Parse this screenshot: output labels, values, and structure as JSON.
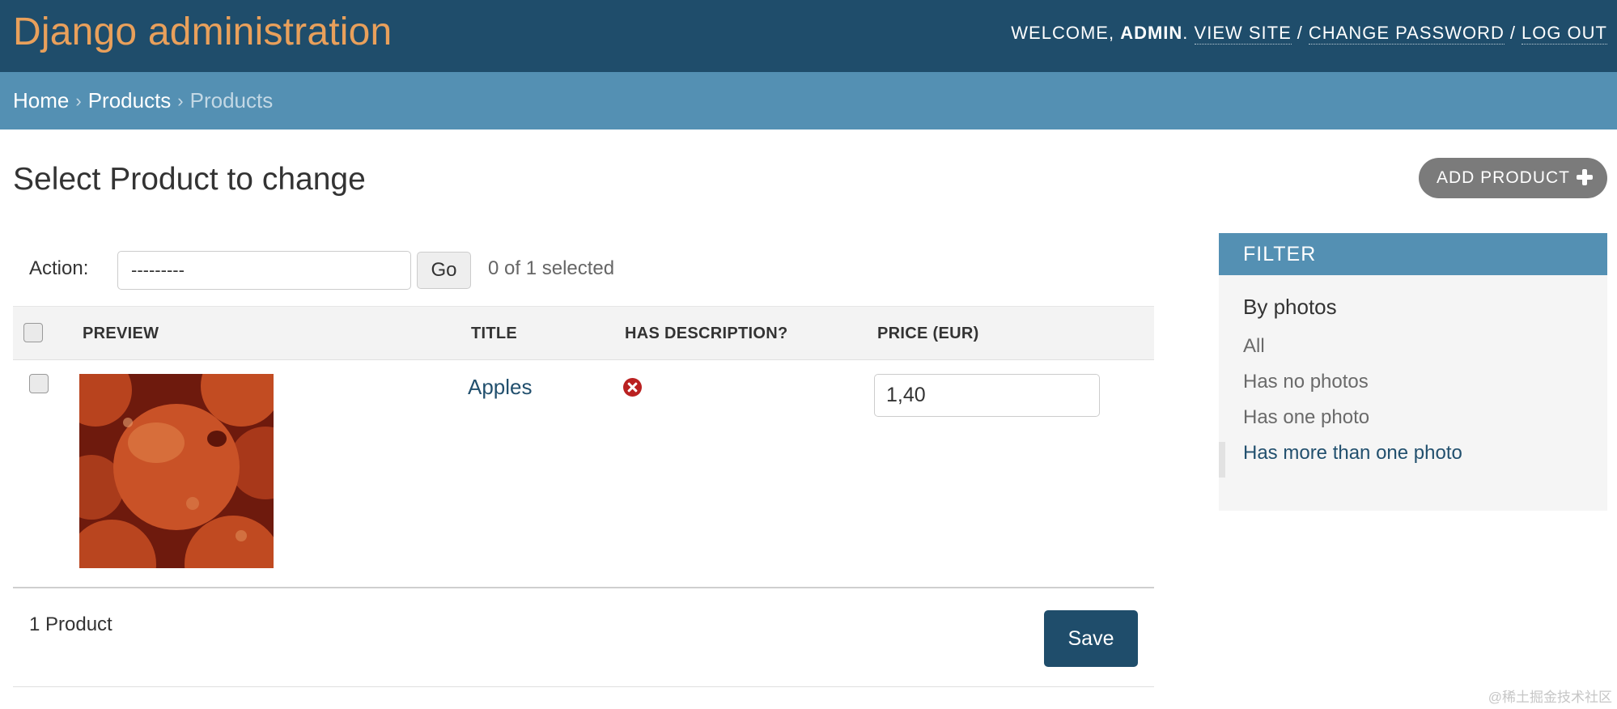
{
  "header": {
    "branding": "Django administration",
    "welcome": "WELCOME,",
    "username": "ADMIN",
    "links": [
      "VIEW SITE",
      "CHANGE PASSWORD",
      "LOG OUT"
    ]
  },
  "breadcrumbs": [
    "Home",
    "Products",
    "Products"
  ],
  "content": {
    "title": "Select Product to change",
    "add_button": "ADD PRODUCT",
    "action_label": "Action:",
    "action_value": "---------",
    "go_button": "Go",
    "selected_count": "0 of 1 selected",
    "columns": [
      "PREVIEW",
      "TITLE",
      "HAS DESCRIPTION?",
      "PRICE (EUR)"
    ],
    "rows": [
      {
        "title": "Apples",
        "has_description": false,
        "price": "1,40"
      }
    ],
    "paginator": "1 Product",
    "save_button": "Save"
  },
  "filter": {
    "heading": "FILTER",
    "subheading": "By photos",
    "items": [
      "All",
      "Has no photos",
      "Has one photo",
      "Has more than one photo"
    ],
    "selected_index": 3
  },
  "watermark": "@稀土掘金技术社区",
  "colors": {
    "header_bg": "#1f4d6b",
    "branding": "#e9a05b",
    "breadcrumbs_bg": "#5490b3",
    "link": "#22506e",
    "error_red": "#ba2121"
  }
}
